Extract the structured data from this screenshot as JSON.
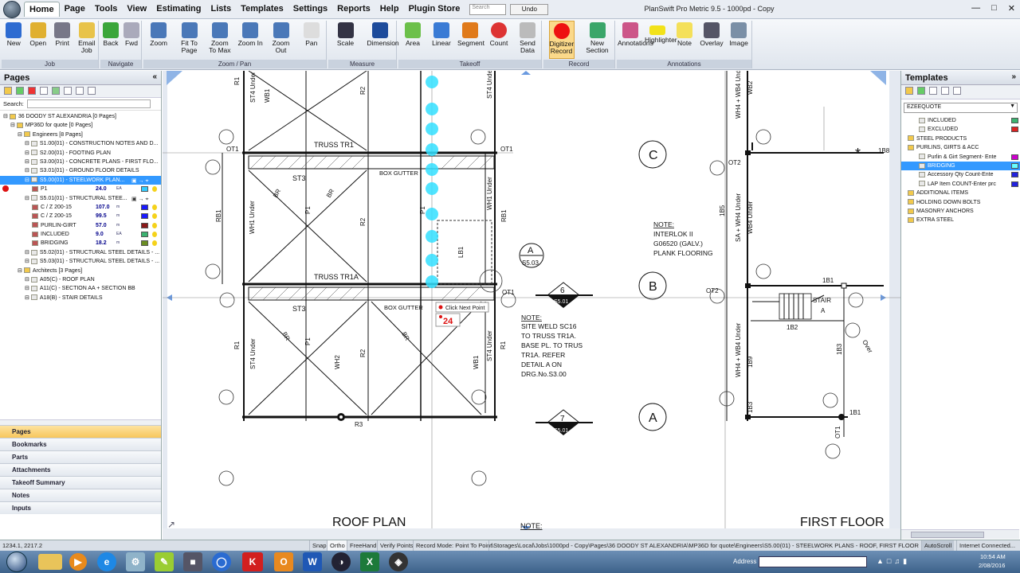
{
  "menu": {
    "tabs": [
      "Home",
      "Page",
      "Tools",
      "View",
      "Estimating",
      "Lists",
      "Templates",
      "Settings",
      "Reports",
      "Help",
      "Plugin Store"
    ],
    "search_placeholder": "Search",
    "undo_label": "Undo",
    "window_title": "PlanSwift Pro Metric 9.5 - 1000pd - Copy"
  },
  "ribbon": {
    "groups": [
      {
        "label": "Job",
        "buttons": [
          "New",
          "Open",
          "Print",
          "Email Job"
        ]
      },
      {
        "label": "Navigate",
        "buttons": [
          "Back",
          "Fwd"
        ]
      },
      {
        "label": "Zoom / Pan",
        "buttons": [
          "Zoom",
          "Fit To Page",
          "Zoom To Max",
          "Zoom In",
          "Zoom Out",
          "Pan"
        ]
      },
      {
        "label": "Measure",
        "buttons": [
          "Scale",
          "Dimension"
        ]
      },
      {
        "label": "Takeoff",
        "buttons": [
          "Area",
          "Linear",
          "Segment",
          "Count",
          "Send Data"
        ]
      },
      {
        "label": "Record",
        "buttons": [
          "Digitizer Record",
          "New Section"
        ]
      },
      {
        "label": "Annotations",
        "buttons": [
          "Annotations",
          "Highlighter",
          "Note",
          "Overlay",
          "Image"
        ]
      }
    ]
  },
  "pages_panel": {
    "title": "Pages",
    "search_label": "Search:",
    "tree": [
      {
        "text": "36 DOODY ST ALEXANDRIA [0 Pages]",
        "level": 0
      },
      {
        "text": "MP36D for quote [0 Pages]",
        "level": 1
      },
      {
        "text": "Engineers [8 Pages]",
        "level": 2
      },
      {
        "text": "S1.00(01) - CONSTRUCTION NOTES AND D...",
        "level": 3
      },
      {
        "text": "S2.00(01) - FOOTING PLAN",
        "level": 3
      },
      {
        "text": "S3.00(01) - CONCRETE PLANS - FIRST FLO...",
        "level": 3
      },
      {
        "text": "S3.01(01) - GROUND FLOOR DETAILS",
        "level": 3
      },
      {
        "text": "S5.00(01) - STEELWORK PLAN...",
        "level": 3,
        "selected": true
      },
      {
        "text": "P1",
        "level": 4,
        "value": "24.0",
        "unit": "EA",
        "color": "#33ccff"
      },
      {
        "text": "S5.01(01) - STRUCTURAL STEE...",
        "level": 3
      },
      {
        "text": "C / Z 200-15",
        "level": 4,
        "value": "107.0",
        "unit": "m",
        "color": "#1a1aff"
      },
      {
        "text": "C / Z 200-15",
        "level": 4,
        "value": "99.5",
        "unit": "m",
        "color": "#1a1aff"
      },
      {
        "text": "PURLIN-GIRT",
        "level": 4,
        "value": "57.0",
        "unit": "m",
        "color": "#8b1a1a"
      },
      {
        "text": "INCLUDED",
        "level": 4,
        "value": "9.0",
        "unit": "EA",
        "color": "#3cb371"
      },
      {
        "text": "BRIDGING",
        "level": 4,
        "value": "18.2",
        "unit": "m",
        "color": "#6b8e23"
      },
      {
        "text": "S5.02(01) - STRUCTURAL STEEL DETAILS - ...",
        "level": 3
      },
      {
        "text": "S5.03(01) - STRUCTURAL STEEL DETAILS - ...",
        "level": 3
      },
      {
        "text": "Architects [3 Pages]",
        "level": 2
      },
      {
        "text": "A05(C) - ROOF PLAN",
        "level": 3
      },
      {
        "text": "A11(C) - SECTION AA + SECTION BB",
        "level": 3
      },
      {
        "text": "A18(B) - STAIR DETAILS",
        "level": 3
      }
    ],
    "bottom_tabs": [
      "Pages",
      "Bookmarks",
      "Parts",
      "Attachments",
      "Takeoff Summary",
      "Notes",
      "Inputs"
    ]
  },
  "templates_panel": {
    "title": "Templates",
    "dropdown": "EZEEQUOTE",
    "tree": [
      {
        "text": "INCLUDED",
        "level": 2,
        "color": "#3cb371"
      },
      {
        "text": "EXCLUDED",
        "level": 2,
        "color": "#dd2222"
      },
      {
        "text": "STEEL PRODUCTS",
        "level": 1
      },
      {
        "text": "PURLINS, GIRTS & ACC",
        "level": 1
      },
      {
        "text": "Purlin & Girt Segment- Ente",
        "level": 2,
        "color": "#cc00cc"
      },
      {
        "text": "BRIDGING",
        "level": 2,
        "selected": true,
        "color": "#66ffff"
      },
      {
        "text": "Accessory Qty Count-Ente",
        "level": 2,
        "color": "#2222dd"
      },
      {
        "text": "LAP Item COUNT-Enter prc",
        "level": 2,
        "color": "#2222dd"
      },
      {
        "text": "ADDITIONAL ITEMS",
        "level": 1
      },
      {
        "text": "HOLDING DOWN BOLTS",
        "level": 1
      },
      {
        "text": "MASONRY ANCHORS",
        "level": 1
      },
      {
        "text": "EXTRA STEEL",
        "level": 1
      }
    ]
  },
  "drawing": {
    "left_plan": {
      "title": "ROOF PLAN",
      "labels": [
        "TRUSS TR1",
        "TRUSS TR1A",
        "BOX GUTTER",
        "BOX GUTTER",
        "ST3",
        "ST3",
        "BR",
        "BR",
        "BR",
        "BR",
        "P1",
        "P1",
        "P1",
        "R2",
        "R2",
        "R2",
        "R1",
        "R1",
        "R1",
        "RB1",
        "RB1",
        "WB1",
        "WB1",
        "WH2",
        "WH1 Under",
        "WH1 Under",
        "ST4 Under",
        "ST4 Under",
        "ST4 Under",
        "ST4 Under",
        "OT1",
        "OT1",
        "OT1",
        "R3",
        "LB1"
      ],
      "note_title": "NOTE:",
      "note_lines": [
        "SITE WELD SC16",
        "TO TRUSS TR1A.",
        "BASE PL. TO TRUS",
        "TR1A. REFER",
        "DETAIL A ON",
        "DRG.No.S3.00"
      ],
      "section_marks": [
        {
          "num": "6",
          "ref": "S5.01"
        },
        {
          "num": "7",
          "ref": "S5.01"
        }
      ],
      "detail_mark": {
        "letter": "A",
        "ref": "S5.03"
      },
      "tooltip": "Click Next Point",
      "count_badge": "24",
      "bottom_note": "NOTE:"
    },
    "right_plan": {
      "title": "FIRST FLOOR",
      "grid_lines": [
        "C",
        "B",
        "A"
      ],
      "note_lines": [
        "NOTE:",
        "INTERLOK II",
        "G06520 (GALV.)",
        "PLANK FLOORING"
      ],
      "labels": [
        "WH4 + WB4 Under",
        "WH4 + WB4 Under",
        "SA + WH4 Under",
        "WB4 Under",
        "OT2",
        "OT2",
        "OT1",
        "1B5",
        "1B1",
        "1B2",
        "1B3",
        "1B9",
        "1B3",
        "1B1",
        "1B8",
        "WB2",
        "STAIR",
        "A",
        "Over"
      ]
    }
  },
  "status": {
    "coords": "1234.1, 2217.2",
    "items": [
      "Snap",
      "Ortho",
      "FreeHand",
      "Verify Points",
      "Record Mode: Point To Point"
    ],
    "path": "\\Storages\\Local\\Jobs\\1000pd - Copy\\Pages\\36 DOODY ST ALEXANDRIA\\MP36D for quote\\Engineers\\S5.00(01) - STEELWORK PLANS - ROOF, FIRST FLOOR & MEZZ",
    "autoscroll": "AutoScroll",
    "internet": "Internet Connected..."
  },
  "taskbar": {
    "address_label": "Address",
    "time": "10:54 AM",
    "date": "2/08/2016"
  },
  "colors": {
    "ribbon_bg": "#e3e8ef",
    "selection": "#3399ff",
    "takeoff_points": "#33e0ff",
    "record_red": "#dd1111"
  }
}
